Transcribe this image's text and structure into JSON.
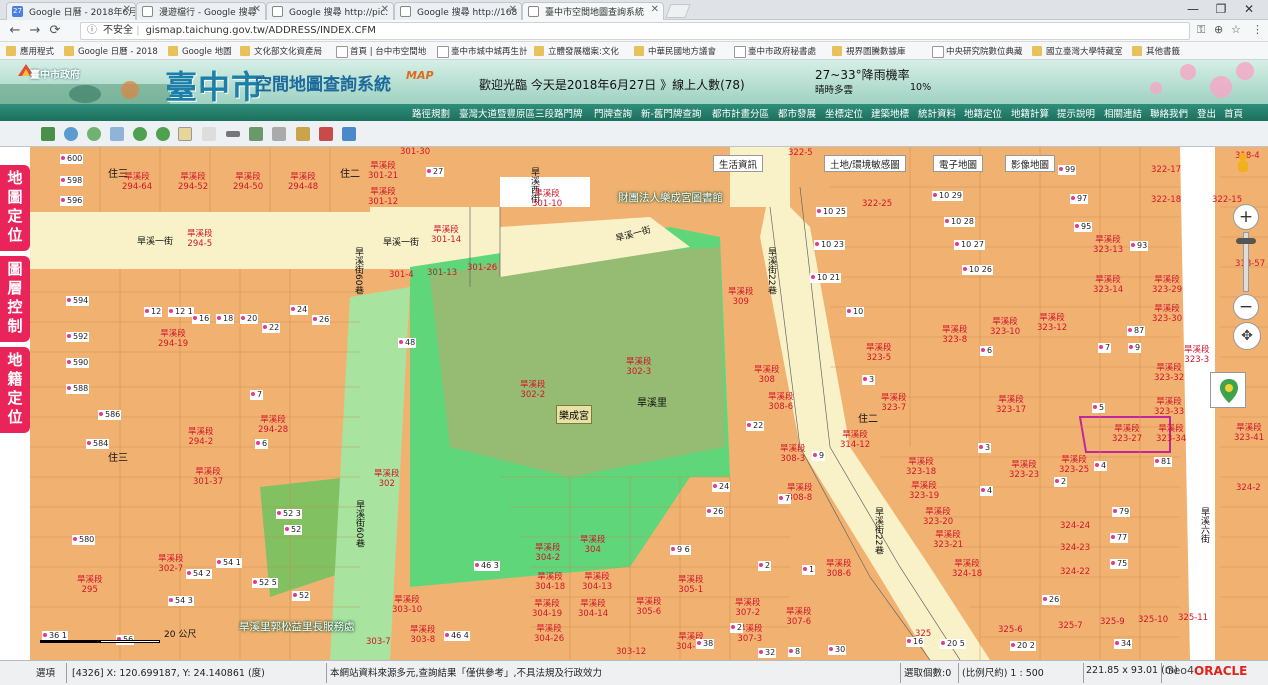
{
  "browser": {
    "tabs": [
      {
        "label": "Google 日曆 - 2018年6月",
        "icon": "calendar-icon"
      },
      {
        "label": "漫遊檔行 - Google 搜尋",
        "icon": "document-icon"
      },
      {
        "label": "Google 搜尋 http://pic.",
        "icon": "document-icon"
      },
      {
        "label": "Google 搜尋 http://168",
        "icon": "document-icon"
      },
      {
        "label": "臺中市空間地圖查詢系統",
        "icon": "document-icon",
        "active": true
      }
    ],
    "url_security": "不安全",
    "url": "gismap.taichung.gov.tw/ADDRESS/INDEX.CFM",
    "bookmarks": [
      "應用程式",
      "Google 日曆 - 2018",
      "Google 地圖",
      "文化部文化資產局",
      "首頁 | 台中市空間地",
      "臺中市城中城再生計",
      "立體發展檔案:文化",
      "中華民國地方議會",
      "臺中市政府秘書處",
      "視界圖騰數據庫",
      "中央研究院數位典藏",
      "國立臺灣大學特藏室",
      "其他書籤"
    ]
  },
  "banner": {
    "city_name": "臺中市政府",
    "big_title": "臺中市",
    "system_title": "空間地圖查詢系統",
    "map_tag": "MAP",
    "welcome": "歡迎光臨 今天是2018年6月27日 》線上人數(78)",
    "temperature": "27~33°降雨機率",
    "weather": "晴時多雲",
    "rain_chance": "10%"
  },
  "menu": [
    "路徑規劃",
    "臺灣大道暨豐原區三段路門牌",
    "門牌查詢",
    "新-舊門牌查詢",
    "都市計畫分區",
    "都市發展",
    "坐標定位",
    "建築地標",
    "統計資料",
    "地籍定位",
    "地籍計算",
    "提示說明",
    "相關連結",
    "聯絡我們",
    "登出",
    "首頁"
  ],
  "side_tabs": [
    "地圖定位",
    "圖層控制",
    "地籍定位"
  ],
  "layer_buttons": [
    "生活資訊",
    "土地/環境敏感圖",
    "電子地圖",
    "影像地圖"
  ],
  "map": {
    "pois": [
      "財團法人樂成宮圖書館",
      "旱溪里郭松益里長服務處"
    ],
    "temple": "樂成宮",
    "village": "旱溪里",
    "zones": [
      "住三",
      "住二",
      "住三",
      "住二",
      "住三"
    ],
    "roads": [
      "旱溪一街",
      "旱溪一街",
      "旱溪西街",
      "旱溪街60巷",
      "旱溪街60巷",
      "旱溪街22巷",
      "旱溪街22巷",
      "旱溪一街",
      "旱溪六街"
    ],
    "parcel_prefix": "旱溪段",
    "parcels": [
      "294-64",
      "294-52",
      "294-50",
      "294-48",
      "301-21",
      "301-12",
      "301-30",
      "301-10",
      "294-5",
      "301-14",
      "301-4",
      "301-13",
      "301-26",
      "294-19",
      "309",
      "302-3",
      "302-2",
      "294-2",
      "294-28",
      "301-37",
      "302",
      "308",
      "308-6",
      "308-3",
      "308-8",
      "314-12",
      "323-7",
      "323-17",
      "323-5",
      "323-8",
      "323-10",
      "323-12",
      "323-13",
      "323-14",
      "323-29",
      "323-30",
      "323-3",
      "323-32",
      "323-33",
      "323-27",
      "323-34",
      "323-41",
      "323-18",
      "323-19",
      "323-20",
      "323-21",
      "323-23",
      "323-25",
      "324-18",
      "324-22",
      "324-23",
      "324-24",
      "304",
      "304-2",
      "304-18",
      "304-13",
      "304-12",
      "304-19",
      "304-14",
      "304-26",
      "305-1",
      "305-6",
      "307-2",
      "307-3",
      "307-6",
      "308-6",
      "303-10",
      "303-8",
      "303-7",
      "303-12",
      "302-7",
      "295",
      "322-5",
      "322-25",
      "322-17",
      "322-18",
      "322-15",
      "318-4",
      "318-57",
      "325",
      "325-6",
      "325-7",
      "325-9",
      "325-10",
      "325-11",
      "322-5",
      "324-2"
    ],
    "plot_numbers": [
      "600",
      "598",
      "596",
      "594",
      "592",
      "590",
      "588",
      "586",
      "584",
      "580",
      "27",
      "48",
      "7",
      "6",
      "12",
      "12 1",
      "16",
      "18",
      "20",
      "22",
      "24",
      "26",
      "52 3",
      "52",
      "46 3",
      "54 1",
      "54 2",
      "52 5",
      "52",
      "54 3",
      "56",
      "36 1",
      "10 25",
      "10 23",
      "10 21",
      "10",
      "10 29",
      "10 28",
      "10 27",
      "10 26",
      "99",
      "97",
      "95",
      "93",
      "87",
      "9",
      "7",
      "5",
      "81",
      "4",
      "6",
      "4",
      "22",
      "9",
      "24",
      "26",
      "7",
      "2",
      "9 6",
      "2",
      "1",
      "3",
      "3",
      "2",
      "8",
      "30",
      "32",
      "38",
      "46 4",
      "16",
      "20 5",
      "20 2",
      "79",
      "77",
      "75",
      "26",
      "34"
    ],
    "scale_label": "20 公尺"
  },
  "status": {
    "mode": "選項",
    "coord": "[4326] X: 120.699187, Y: 24.140861 (度)",
    "disclaimer": "本網站資料來源多元,查詢結果「僅供參考」,不具法規及行政效力",
    "selected": "選取個數:0",
    "scale": "(比例尺約) 1 : 500",
    "extent": "221.85 x 93.01 (m)",
    "geo4": "Geo4",
    "oracle": "ORACLE"
  }
}
